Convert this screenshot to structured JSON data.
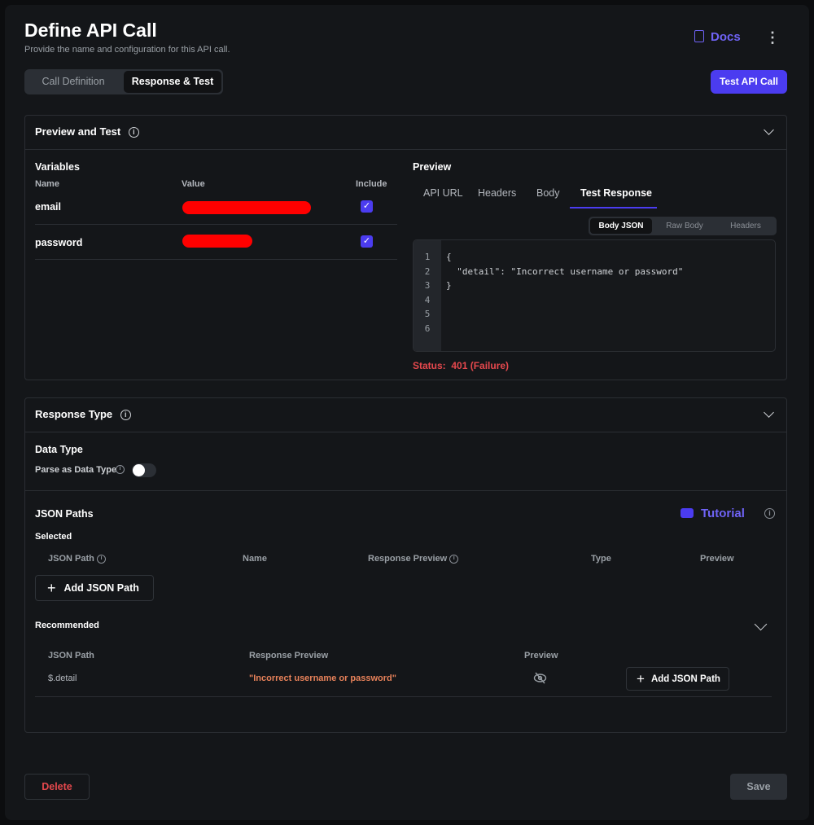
{
  "header": {
    "title": "Define API Call",
    "subtitle": "Provide the name and configuration for this API call.",
    "docs_label": "Docs",
    "menu_icon": "more-vertical-icon",
    "test_button": "Test API Call"
  },
  "tabs": [
    {
      "label": "Call Definition",
      "active": false
    },
    {
      "label": "Response & Test",
      "active": true
    }
  ],
  "preview_test": {
    "title": "Preview and Test",
    "variables": {
      "title": "Variables",
      "columns": [
        "Name",
        "Value",
        "Include"
      ],
      "rows": [
        {
          "name": "email",
          "value": "[redacted]",
          "include": true
        },
        {
          "name": "password",
          "value": "[redacted]",
          "include": true
        }
      ]
    },
    "preview": {
      "title": "Preview",
      "tabs": [
        "API URL",
        "Headers",
        "Body",
        "Test Response"
      ],
      "active_tab": "Test Response",
      "subtabs": [
        "Body JSON",
        "Raw Body",
        "Headers"
      ],
      "active_subtab": "Body JSON",
      "line_numbers": [
        "1",
        "2",
        "3",
        "4",
        "5",
        "6"
      ],
      "code": "{\n  \"detail\": \"Incorrect username or password\"\n}",
      "status_label": "Status:",
      "status_value": "401 (Failure)"
    }
  },
  "response_type": {
    "title": "Response Type",
    "data_type_title": "Data Type",
    "parse_label": "Parse as Data Type",
    "parse_enabled": false
  },
  "json_paths": {
    "title": "JSON Paths",
    "tutorial_label": "Tutorial",
    "selected_title": "Selected",
    "selected_columns": [
      "JSON Path",
      "Name",
      "Response Preview",
      "Type",
      "Preview"
    ],
    "add_button": "Add JSON Path",
    "recommended_title": "Recommended",
    "recommended_columns": [
      "JSON Path",
      "Response Preview",
      "Preview"
    ],
    "recommended_rows": [
      {
        "path": "$.detail",
        "preview": "\"Incorrect username or password\"",
        "add_label": "Add JSON Path"
      }
    ]
  },
  "footer": {
    "delete": "Delete",
    "save": "Save"
  },
  "colors": {
    "accent": "#4b3cf0",
    "error": "#e5484d",
    "preview_string": "#e8825a"
  }
}
